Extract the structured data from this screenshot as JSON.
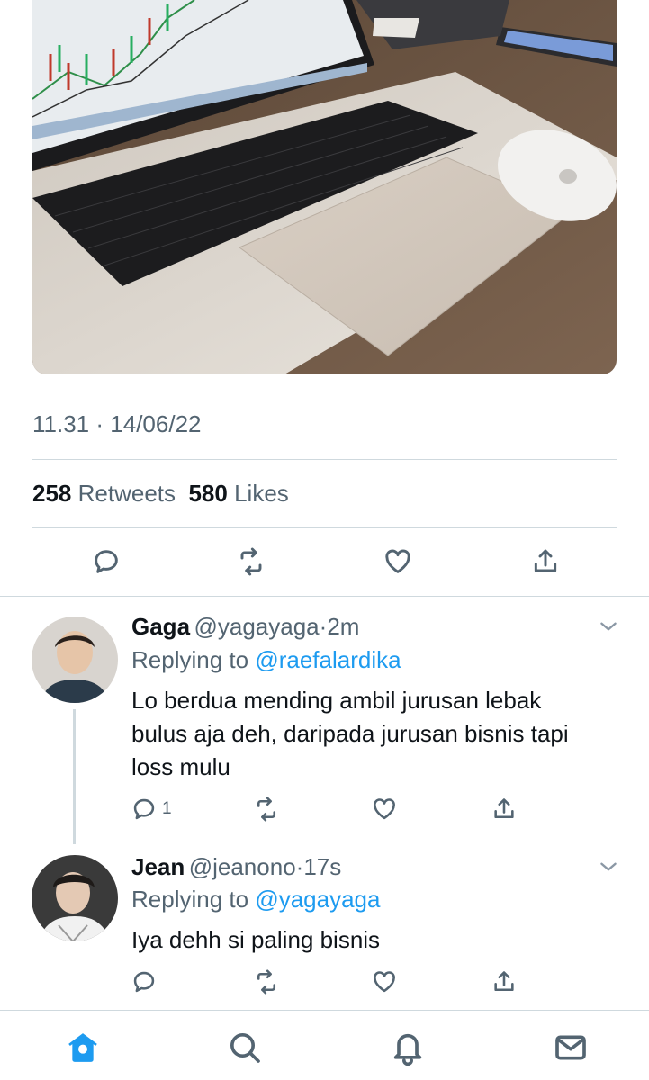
{
  "tweet": {
    "time": "11.31",
    "separator": "·",
    "date": "14/06/22",
    "retweets_count": "258",
    "retweets_label": "Retweets",
    "likes_count": "580",
    "likes_label": "Likes",
    "photo_icon": "laptop-trading-photo"
  },
  "replies": [
    {
      "name": "Gaga",
      "handle": "@yagayaga",
      "separator": "·",
      "time": "2m",
      "replying_prefix": "Replying to",
      "replying_to": "@raefalardika",
      "text_lines": [
        "Lo berdua mending ambil jurusan lebak",
        "bulus aja deh, daripada jurusan bisnis tapi",
        "loss mulu"
      ],
      "reply_count": "1"
    },
    {
      "name": "Jean",
      "handle": "@jeanono",
      "separator": "·",
      "time": "17s",
      "replying_prefix": "Replying to",
      "replying_to": "@yagayaga",
      "text_lines": [
        "Iya dehh si paling bisnis"
      ],
      "reply_count": ""
    }
  ],
  "colors": {
    "accent": "#1d9bf0",
    "text_primary": "#0f1419",
    "text_secondary": "#536471",
    "divider": "#cfd9de"
  },
  "icons": {
    "reply": "reply-icon",
    "retweet": "retweet-icon",
    "like": "heart-icon",
    "share": "share-icon",
    "more": "chevron-down-icon",
    "nav": [
      "home-icon",
      "search-icon",
      "bell-icon",
      "mail-icon"
    ]
  }
}
